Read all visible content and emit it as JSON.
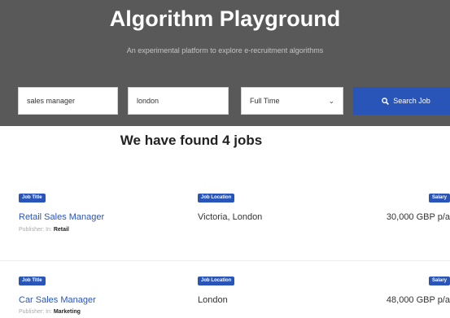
{
  "hero": {
    "title": "Algorithm Playground",
    "subtitle": "An experimental platform to explore e-recruitment algorithms"
  },
  "search": {
    "keyword": "sales manager",
    "location": "london",
    "job_type": "Full Time",
    "button_label": "Search Job"
  },
  "results_heading": "We have found 4 jobs",
  "labels": {
    "job_title": "Job Title",
    "job_location": "Job Location",
    "salary": "Salary",
    "publisher_prefix": "Publisher: In:"
  },
  "jobs": [
    {
      "title": "Retail Sales Manager",
      "category": "Retail",
      "location": "Victoria, London",
      "salary": "30,000 GBP p/a"
    },
    {
      "title": "Car Sales Manager",
      "category": "Marketing",
      "location": "London",
      "salary": "48,000 GBP p/a"
    }
  ],
  "colors": {
    "hero_bg": "#595959",
    "accent": "#2a55b8"
  }
}
